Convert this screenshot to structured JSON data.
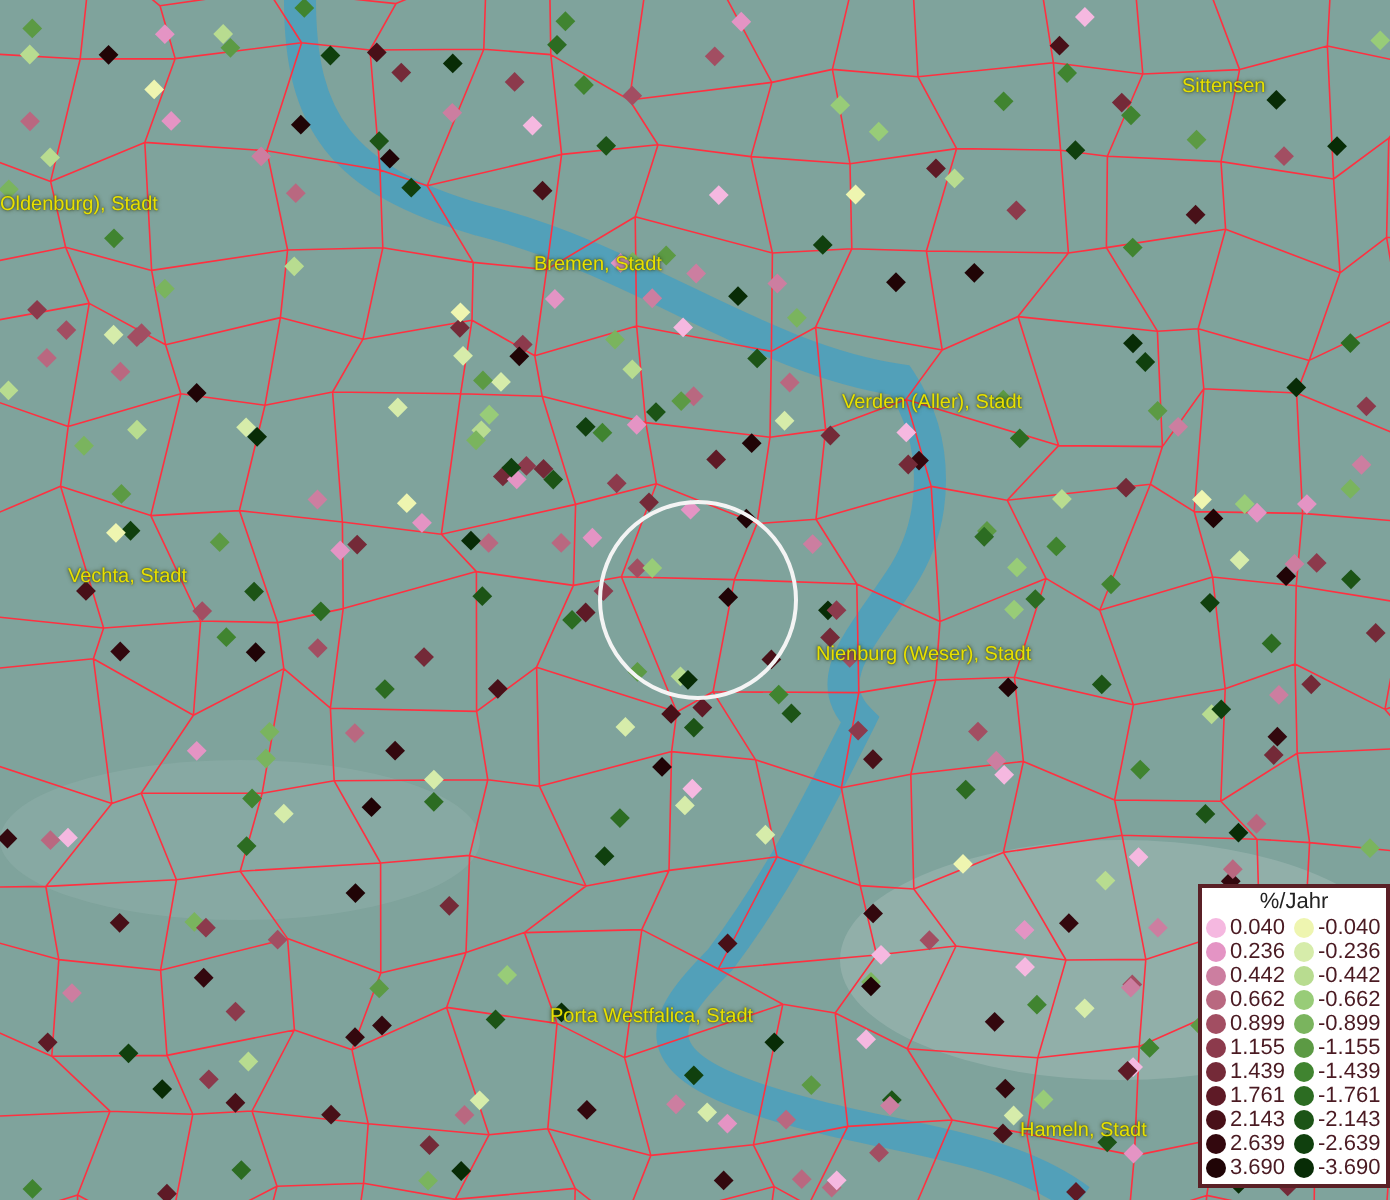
{
  "map": {
    "places": [
      {
        "name": "Oldenburg), Stadt"
      },
      {
        "name": "Sittensen"
      },
      {
        "name": "Bremen, Stadt"
      },
      {
        "name": "Verden (Aller), Stadt"
      },
      {
        "name": "Vechta, Stadt"
      },
      {
        "name": "Nienburg (Weser), Stadt"
      },
      {
        "name": "Porta Westfalica, Stadt"
      },
      {
        "name": "Hameln, Stadt"
      }
    ]
  },
  "legend": {
    "title": "%/Jahr",
    "rows": [
      {
        "positive": {
          "value": "0.040",
          "color": "#f5b8e0"
        },
        "negative": {
          "value": "-0.040",
          "color": "#eef5b0"
        }
      },
      {
        "positive": {
          "value": "0.236",
          "color": "#e494c4"
        },
        "negative": {
          "value": "-0.236",
          "color": "#d6ecaa"
        }
      },
      {
        "positive": {
          "value": "0.442",
          "color": "#cc7ea0"
        },
        "negative": {
          "value": "-0.442",
          "color": "#b8dc90"
        }
      },
      {
        "positive": {
          "value": "0.662",
          "color": "#b96880"
        },
        "negative": {
          "value": "-0.662",
          "color": "#98cc78"
        }
      },
      {
        "positive": {
          "value": "0.899",
          "color": "#a24e62"
        },
        "negative": {
          "value": "-0.899",
          "color": "#7ab45e"
        }
      },
      {
        "positive": {
          "value": "1.155",
          "color": "#8c3a4c"
        },
        "negative": {
          "value": "-1.155",
          "color": "#5c9a44"
        }
      },
      {
        "positive": {
          "value": "1.439",
          "color": "#742a38"
        },
        "negative": {
          "value": "-1.439",
          "color": "#408430"
        }
      },
      {
        "positive": {
          "value": "1.761",
          "color": "#5e1a26"
        },
        "negative": {
          "value": "-1.761",
          "color": "#2c6c22"
        }
      },
      {
        "positive": {
          "value": "2.143",
          "color": "#481018"
        },
        "negative": {
          "value": "-2.143",
          "color": "#1c5416"
        }
      },
      {
        "positive": {
          "value": "2.639",
          "color": "#33080e"
        },
        "negative": {
          "value": "-2.639",
          "color": "#10400e"
        }
      },
      {
        "positive": {
          "value": "3.690",
          "color": "#200406"
        },
        "negative": {
          "value": "-3.690",
          "color": "#082c06"
        }
      }
    ]
  }
}
